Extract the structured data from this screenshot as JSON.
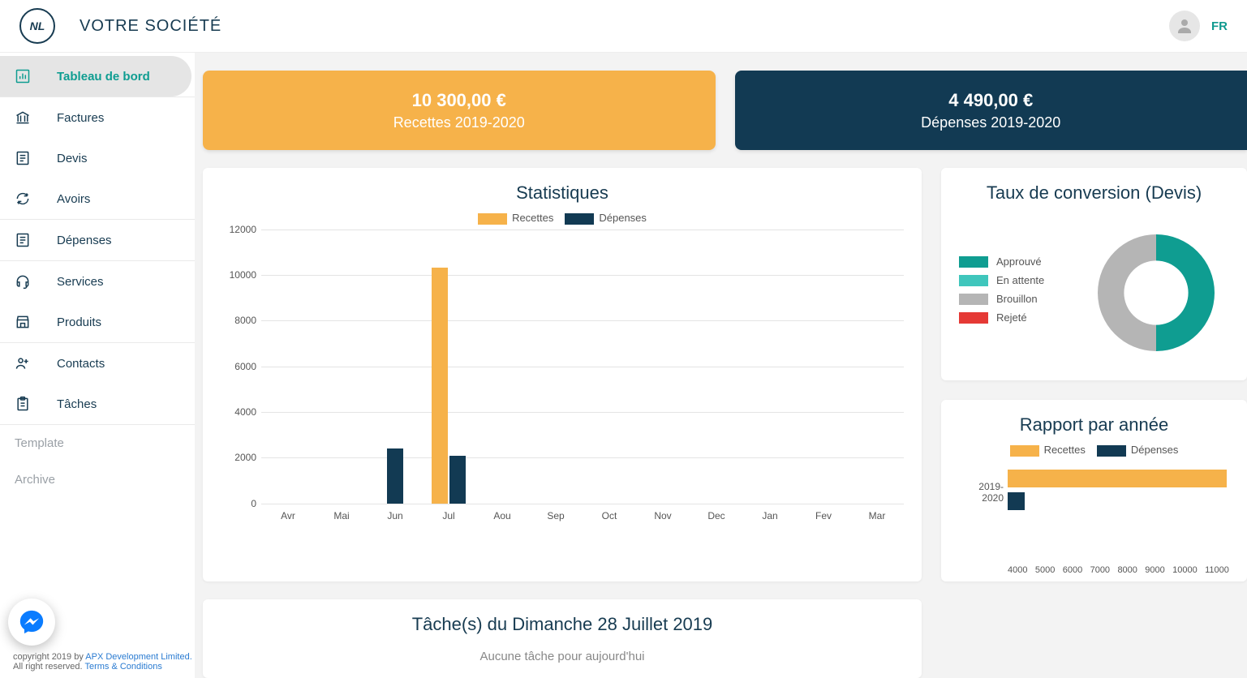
{
  "header": {
    "logo_text": "NL",
    "company": "VOTRE SOCIÉTÉ",
    "lang": "FR"
  },
  "sidebar": {
    "items": [
      {
        "icon": "dashboard",
        "label": "Tableau de bord"
      },
      {
        "icon": "bank",
        "label": "Factures"
      },
      {
        "icon": "list",
        "label": "Devis"
      },
      {
        "icon": "refresh",
        "label": "Avoirs"
      },
      {
        "icon": "list",
        "label": "Dépenses"
      },
      {
        "icon": "headset",
        "label": "Services"
      },
      {
        "icon": "store",
        "label": "Produits"
      },
      {
        "icon": "contacts",
        "label": "Contacts"
      },
      {
        "icon": "clipboard",
        "label": "Tâches"
      }
    ],
    "sub": [
      "Template",
      "Archive"
    ]
  },
  "cards": {
    "revenue": {
      "value": "10 300,00 €",
      "label": "Recettes 2019-2020"
    },
    "expense": {
      "value": "4 490,00 €",
      "label": "Dépenses 2019-2020"
    }
  },
  "chart_data": [
    {
      "id": "monthly",
      "type": "bar",
      "title": "Statistiques",
      "categories": [
        "Avr",
        "Mai",
        "Jun",
        "Jul",
        "Aou",
        "Sep",
        "Oct",
        "Nov",
        "Dec",
        "Jan",
        "Fev",
        "Mar"
      ],
      "series": [
        {
          "name": "Recettes",
          "color": "#f6b24a",
          "values": [
            0,
            0,
            0,
            10300,
            0,
            0,
            0,
            0,
            0,
            0,
            0,
            0
          ]
        },
        {
          "name": "Dépenses",
          "color": "#123a53",
          "values": [
            0,
            0,
            2400,
            2090,
            0,
            0,
            0,
            0,
            0,
            0,
            0,
            0
          ]
        }
      ],
      "ylim": [
        0,
        12000
      ],
      "yticks": [
        0,
        2000,
        4000,
        6000,
        8000,
        10000,
        12000
      ]
    },
    {
      "id": "conversion",
      "type": "pie",
      "title": "Taux de conversion  (Devis)",
      "slices": [
        {
          "name": "Approuvé",
          "color": "#0f9d91",
          "value": 50
        },
        {
          "name": "En attente",
          "color": "#3fc6bc",
          "value": 0
        },
        {
          "name": "Brouillon",
          "color": "#b5b5b5",
          "value": 50
        },
        {
          "name": "Rejeté",
          "color": "#e53935",
          "value": 0
        }
      ]
    },
    {
      "id": "yearly",
      "type": "bar",
      "orientation": "horizontal",
      "title": "Rapport par année",
      "categories": [
        "2019-2020"
      ],
      "series": [
        {
          "name": "Recettes",
          "color": "#f6b24a",
          "values": [
            10300
          ]
        },
        {
          "name": "Dépenses",
          "color": "#123a53",
          "values": [
            4490
          ]
        }
      ],
      "xlim": [
        4000,
        11000
      ],
      "xticks": [
        4000,
        5000,
        6000,
        7000,
        8000,
        9000,
        10000,
        11000
      ]
    }
  ],
  "tasks": {
    "title": "Tâche(s) du  Dimanche 28 Juillet 2019",
    "empty": "Aucune tâche pour aujourd'hui"
  },
  "footer": {
    "line1a": "copyright 2019 by ",
    "line1b": "APX Development Limited.",
    "line2a": "All right reserved. ",
    "line2b": "Terms & Conditions"
  }
}
